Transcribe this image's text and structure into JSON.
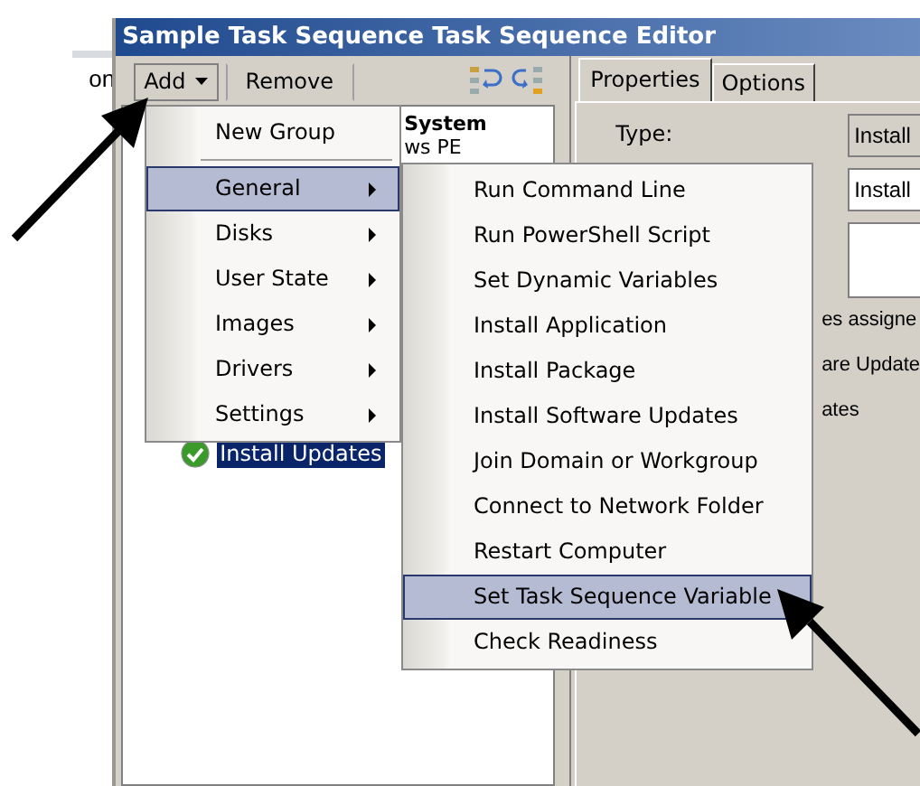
{
  "background_fragment": "on",
  "window": {
    "title": "Sample Task Sequence Task Sequence Editor"
  },
  "toolbar": {
    "buttons": [
      {
        "label": "Add",
        "kind": "dropdown"
      },
      {
        "label": "Remove",
        "kind": "plain"
      }
    ]
  },
  "tree": {
    "items": [
      {
        "label": "System",
        "kind": "group",
        "selected": false
      },
      {
        "label": "ws PE",
        "kind": "partial",
        "selected": false
      },
      {
        "label": "Install Updates",
        "kind": "step",
        "selected": true
      }
    ]
  },
  "add_menu": {
    "items": [
      {
        "label": "New Group",
        "kind": "item",
        "submenu": false,
        "selected": false
      },
      {
        "kind": "separator"
      },
      {
        "label": "General",
        "kind": "item",
        "submenu": true,
        "selected": true
      },
      {
        "label": "Disks",
        "kind": "item",
        "submenu": true,
        "selected": false
      },
      {
        "label": "User State",
        "kind": "item",
        "submenu": true,
        "selected": false
      },
      {
        "label": "Images",
        "kind": "item",
        "submenu": true,
        "selected": false
      },
      {
        "label": "Drivers",
        "kind": "item",
        "submenu": true,
        "selected": false
      },
      {
        "label": "Settings",
        "kind": "item",
        "submenu": true,
        "selected": false
      }
    ]
  },
  "general_submenu": {
    "items": [
      {
        "label": "Run Command Line",
        "selected": false
      },
      {
        "label": "Run PowerShell Script",
        "selected": false
      },
      {
        "label": "Set Dynamic Variables",
        "selected": false
      },
      {
        "label": "Install Application",
        "selected": false
      },
      {
        "label": "Install Package",
        "selected": false
      },
      {
        "label": "Install Software Updates",
        "selected": false
      },
      {
        "label": "Join Domain or Workgroup",
        "selected": false
      },
      {
        "label": "Connect to Network Folder",
        "selected": false
      },
      {
        "label": "Restart Computer",
        "selected": false
      },
      {
        "label": "Set Task Sequence Variable",
        "selected": true
      },
      {
        "label": "Check Readiness",
        "selected": false
      }
    ]
  },
  "properties": {
    "tabs": [
      {
        "label": "Properties",
        "selected": true
      },
      {
        "label": "Options",
        "selected": false
      }
    ],
    "type_label": "Type:",
    "fields": [
      {
        "kind": "readonly",
        "value": "Install"
      },
      {
        "kind": "text",
        "value": "Install"
      },
      {
        "kind": "multiline"
      }
    ],
    "text_fragments": [
      "es assigne",
      "are Update",
      "ates"
    ]
  }
}
